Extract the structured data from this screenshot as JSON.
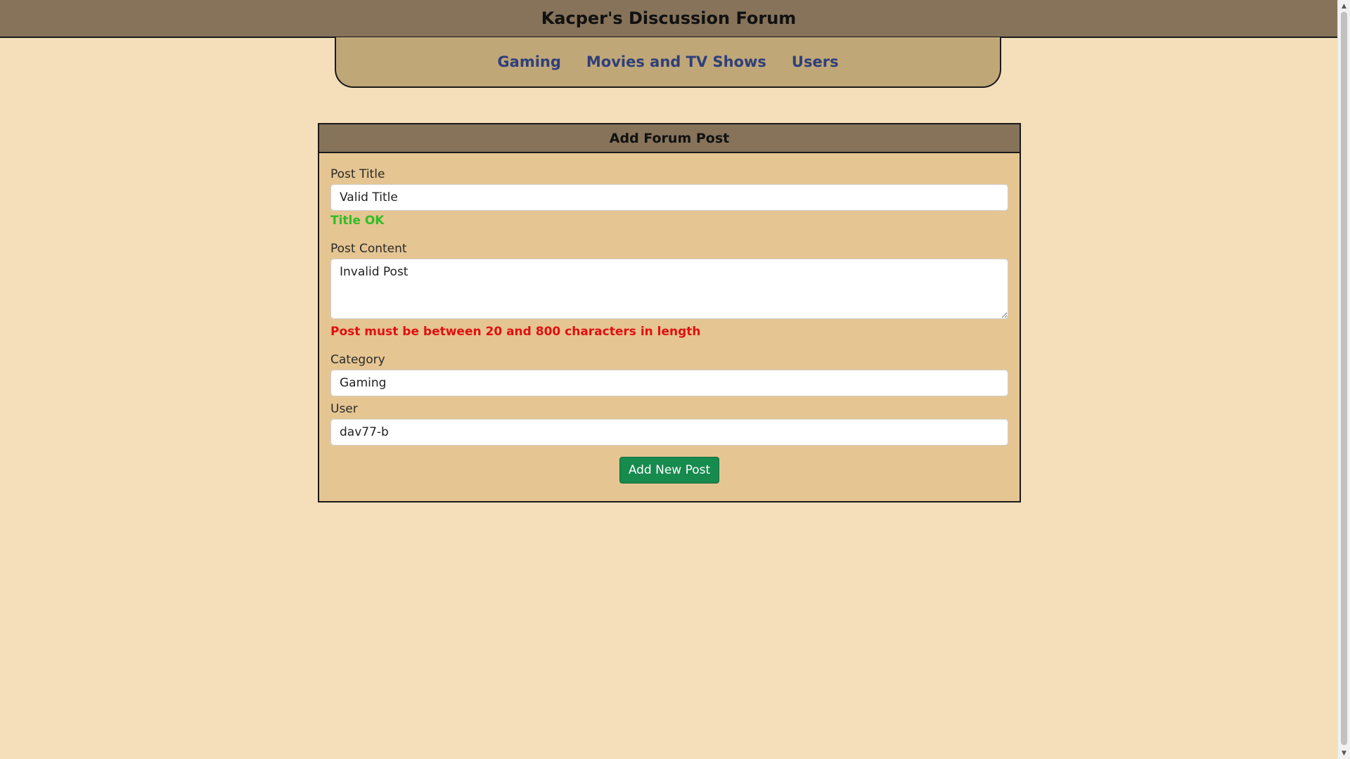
{
  "header": {
    "title": "Kacper's Discussion Forum"
  },
  "nav": {
    "items": [
      {
        "label": "Gaming"
      },
      {
        "label": "Movies and TV Shows"
      },
      {
        "label": "Users"
      }
    ]
  },
  "form": {
    "heading": "Add Forum Post",
    "title_label": "Post Title",
    "title_value": "Valid Title",
    "title_status": "Title OK",
    "content_label": "Post Content",
    "content_value": "Invalid Post",
    "content_error": "Post must be between 20 and 800 characters in length",
    "category_label": "Category",
    "category_value": "Gaming",
    "user_label": "User",
    "user_value": "dav77-b",
    "submit_label": "Add New Post"
  },
  "colors": {
    "background": "#f5dfba",
    "header": "#86735a",
    "nav": "#c0a777",
    "panel": "#e5c592",
    "nav_link": "#2f3f7a",
    "valid": "#2fbf25",
    "error": "#e01010",
    "button": "#178a4e"
  },
  "icons": {
    "scroll_up": "scroll-up-arrow-icon",
    "scroll_down": "scroll-down-arrow-icon",
    "resize": "textarea-resize-handle-icon"
  }
}
